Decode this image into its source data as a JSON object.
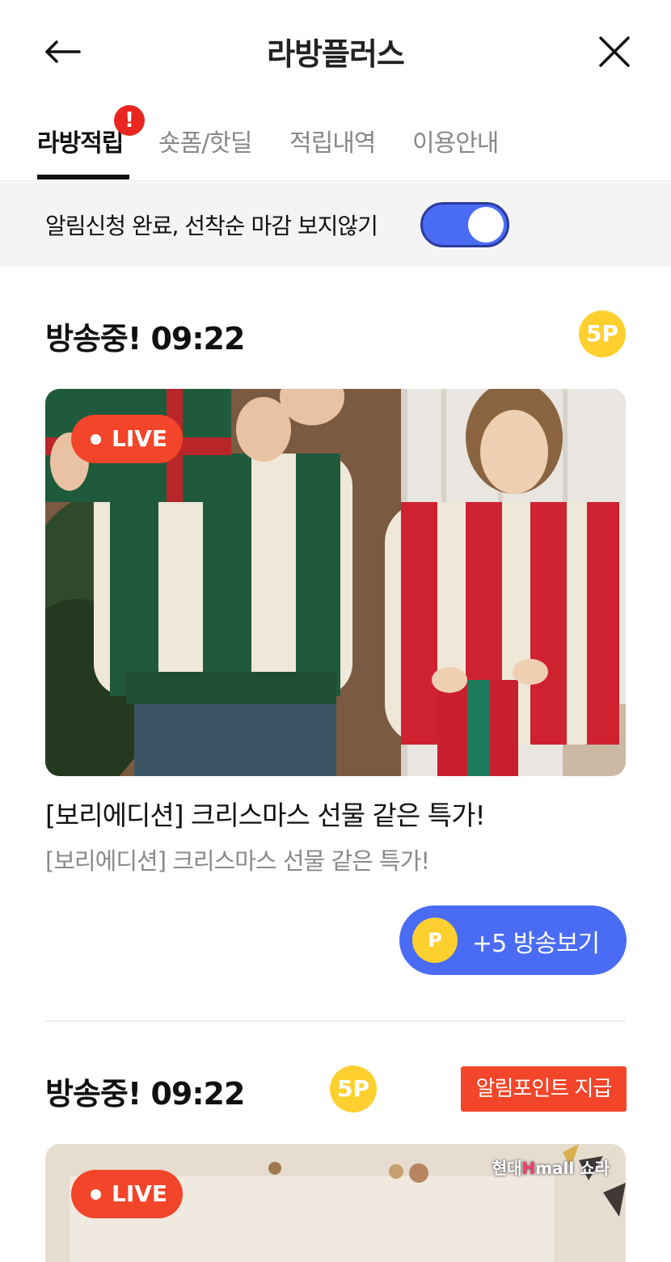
{
  "header": {
    "title": "라방플러스",
    "back_icon": "arrow-left-icon",
    "close_icon": "close-icon"
  },
  "tabs": [
    {
      "label": "라방적립",
      "active": true
    },
    {
      "label": "숏폼/핫딜",
      "active": false
    },
    {
      "label": "적립내역",
      "active": false
    },
    {
      "label": "이용안내",
      "active": false
    }
  ],
  "tab_alert": "!",
  "notice": {
    "text": "알림신청 완료, 선착순 마감 보지않기",
    "toggle_on": true
  },
  "colors": {
    "accent_blue": "#4a6cf5",
    "live_red": "#f2452a",
    "point_yellow": "#fdd02f"
  },
  "cards": [
    {
      "status": "방송중! 09:22",
      "points": "5P",
      "live_label": "LIVE",
      "title": "[보리에디션] 크리스마스 선물 같은 특가!",
      "subtitle": "[보리에디션] 크리스마스 선물 같은 특가!",
      "watch_coin": "P",
      "watch_label": "+5 방송보기"
    },
    {
      "status": "방송중! 09:22",
      "points": "5P",
      "alarm_tag": "알림포인트 지급",
      "live_label": "LIVE",
      "brand_watermark": "현대Hmall",
      "brand_highlight": "H",
      "brand_tail": "mall 쇼라"
    }
  ]
}
